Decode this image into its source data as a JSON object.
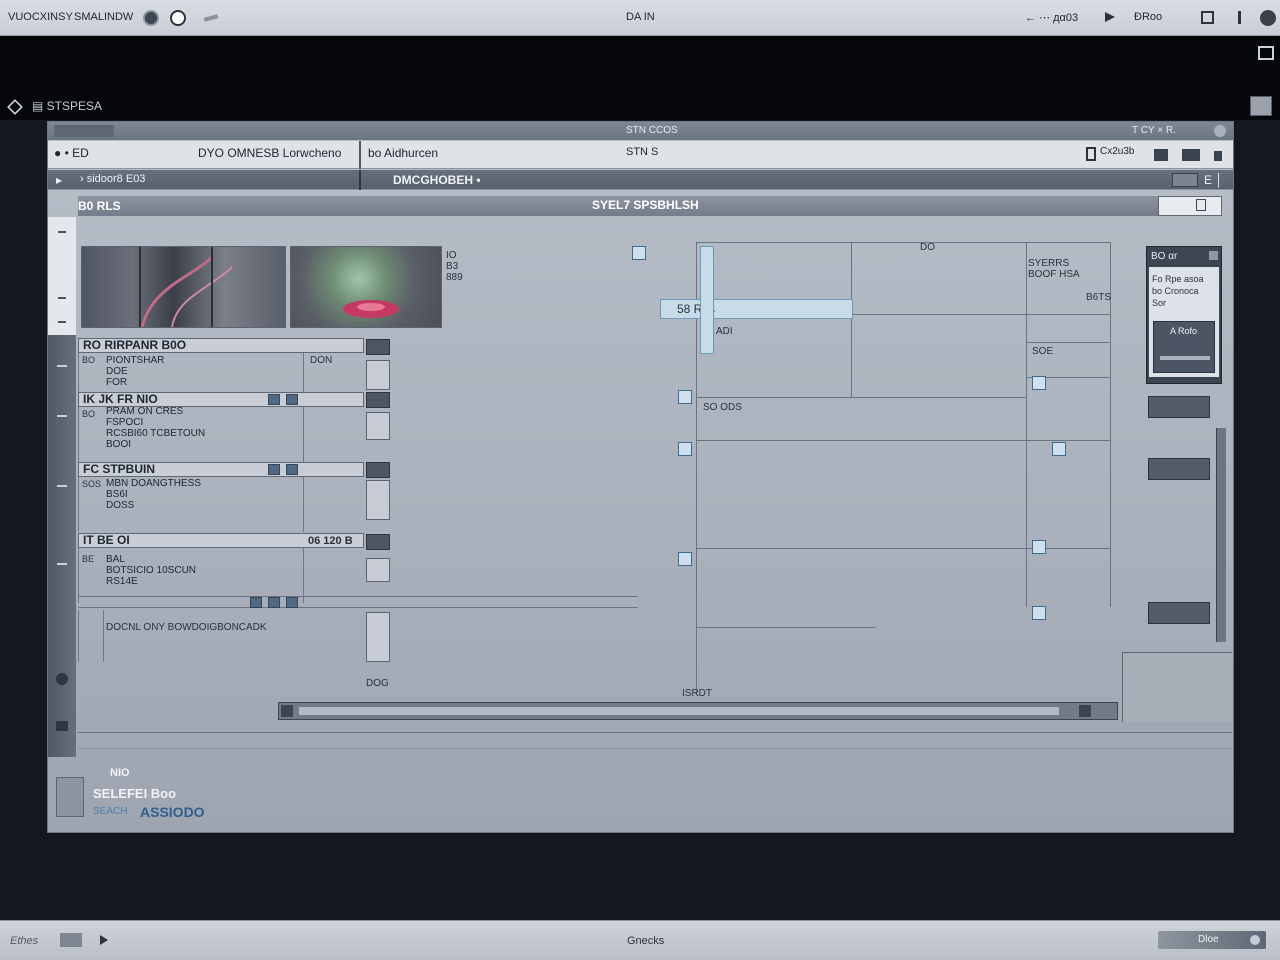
{
  "os_bar": {
    "left_text": "VUOCXINSY",
    "left_text2": "SMALINDW",
    "center_text": "DA IN",
    "right_text": "← ⋯  дα03",
    "right_text2": "ĐRoo"
  },
  "top_left": {
    "label": "▤ STSPESA"
  },
  "window": {
    "title": "STN CCOS",
    "title_controls": "T  CY  ×  R.",
    "toolbar1": {
      "left": "● •  ED",
      "field1": "DYO OMNESB Lorwcheno",
      "field2": "bo Aidhurcen",
      "center": "STN S",
      "right": "Cx2u3b"
    },
    "toolbar2": {
      "left": "▸",
      "field1": "› sidoor8 E03",
      "field2": "DMCGHOBEH •",
      "right": "E │"
    },
    "header": {
      "left": "B0 RLS",
      "center": "SYEL7 SPSBHLSH"
    },
    "thumb_side_label": "IO\nB3\n889",
    "sections": [
      {
        "num": "RO",
        "title": "RIRPANR B0O",
        "num2": "BO",
        "lines": "PIONTSHAR\nDOE\nFOR",
        "side": "DON"
      },
      {
        "num": "IK",
        "title": "JK FR NIO",
        "num2": "BO",
        "lines": "PRAM ON CRES\nFSPOCI\nRCSBI60 TCBETOUN\nBOOI",
        "side": ""
      },
      {
        "num": "FC",
        "title": "STPBUIN",
        "num2": "SOS",
        "lines": "MBN DOANGTHESS\nBS6I\nDOSS",
        "side": ""
      },
      {
        "num": "IT",
        "title": "BE OI",
        "num2": "BE",
        "lines": "BAL\nBOTSICIO 10SCUN\nRS14E",
        "side": "06 120 B"
      }
    ],
    "bottom_row_label": "DOCNL ONY BOWDOIGBONCADK",
    "grid_labels": {
      "top_a": "DO",
      "highlight": "58 Ras",
      "mid1": "ADI",
      "r1": "SYERRS\nBOOF HSA",
      "r2": "B6TS",
      "r3": "SOE",
      "mid2": "SO  ODS",
      "footer_mark": "DOG",
      "bottom_mid": "ISRDT"
    },
    "right_panel": {
      "title": "BO  αr",
      "text": "Fo Rpe asoa\nbo Cronoca\nSor",
      "button": "A Rofo"
    },
    "footer": {
      "l1": "NIO",
      "l2": "SELEFEI Boo",
      "l3": "ASSIODO",
      "l3a": "SEACH"
    }
  },
  "taskbar": {
    "left": "Ethes",
    "center": "Gnecks",
    "right": "Dloe"
  }
}
